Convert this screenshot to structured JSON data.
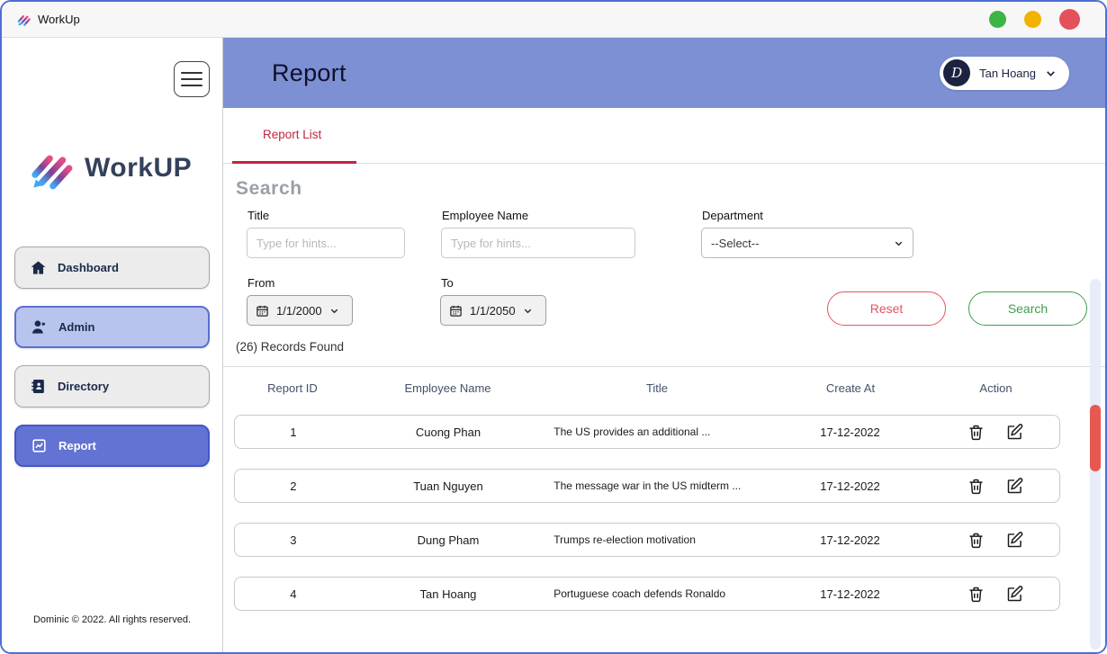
{
  "window": {
    "title": "WorkUp"
  },
  "sidebar": {
    "logo_text": "WorkUP",
    "items": [
      {
        "label": "Dashboard",
        "icon": "home-icon"
      },
      {
        "label": "Admin",
        "icon": "person-icon"
      },
      {
        "label": "Directory",
        "icon": "contacts-book-icon"
      },
      {
        "label": "Report",
        "icon": "report-chart-icon"
      }
    ],
    "footer": "Dominic © 2022. All rights reserved."
  },
  "header": {
    "title": "Report",
    "user": {
      "initial": "D",
      "name": "Tan Hoang"
    }
  },
  "tabs": [
    {
      "label": "Report List"
    }
  ],
  "search": {
    "heading": "Search",
    "fields": {
      "title": {
        "label": "Title",
        "placeholder": "Type for hints..."
      },
      "employee": {
        "label": "Employee Name",
        "placeholder": "Type for hints..."
      },
      "department": {
        "label": "Department",
        "value": "--Select--"
      },
      "from": {
        "label": "From",
        "value": "1/1/2000"
      },
      "to": {
        "label": "To",
        "value": "1/1/2050"
      }
    },
    "reset_label": "Reset",
    "search_label": "Search"
  },
  "results": {
    "count_text": "(26) Records Found",
    "columns": [
      "Report ID",
      "Employee Name",
      "Title",
      "Create At",
      "Action"
    ],
    "rows": [
      {
        "id": "1",
        "employee": "Cuong Phan",
        "title": "The US provides an additional ...",
        "created": "17-12-2022"
      },
      {
        "id": "2",
        "employee": "Tuan Nguyen",
        "title": "The message war in the US midterm ...",
        "created": "17-12-2022"
      },
      {
        "id": "3",
        "employee": "Dung Pham",
        "title": "Trumps re-election motivation",
        "created": "17-12-2022"
      },
      {
        "id": "4",
        "employee": "Tan Hoang",
        "title": "Portuguese coach defends Ronaldo",
        "created": "17-12-2022"
      }
    ]
  },
  "colors": {
    "header_blue": "#7c90d3",
    "active_item_blue": "#6273d4",
    "tab_red": "#c0263e",
    "reset_red": "#e4555f",
    "search_green": "#3f9e4d",
    "scroll_thumb_red": "#e8584e"
  }
}
